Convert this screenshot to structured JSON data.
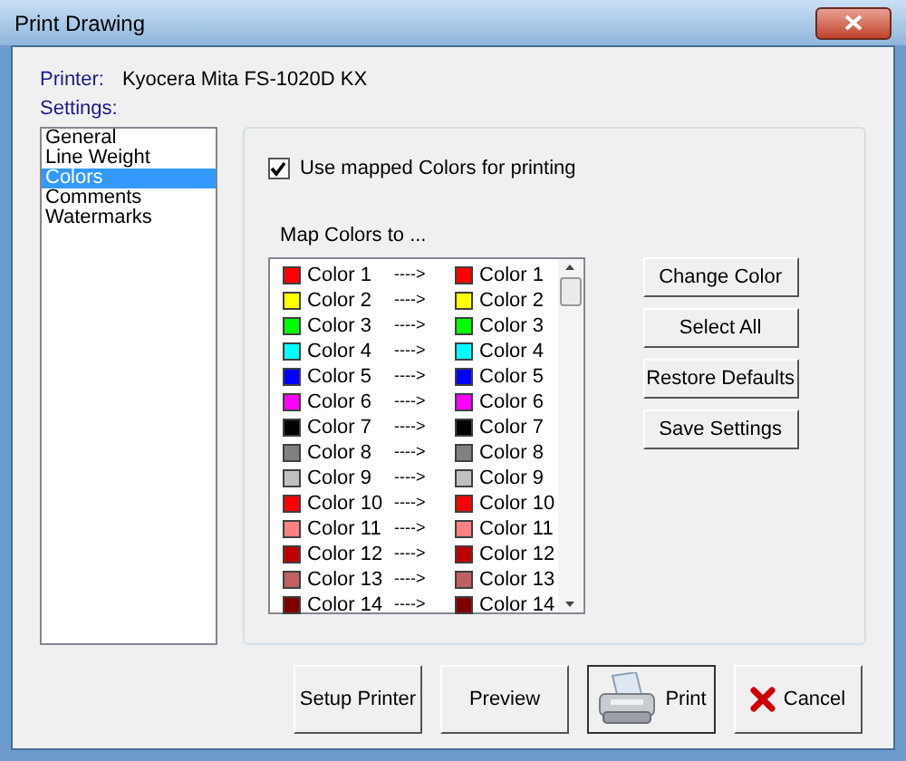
{
  "window": {
    "title": "Print Drawing"
  },
  "printer": {
    "label": "Printer:",
    "value": "Kyocera Mita FS-1020D KX"
  },
  "settings": {
    "label": "Settings:",
    "items": [
      {
        "label": "General",
        "selected": false
      },
      {
        "label": "Line Weight",
        "selected": false
      },
      {
        "label": "Colors",
        "selected": true
      },
      {
        "label": "Comments",
        "selected": false
      },
      {
        "label": "Watermarks",
        "selected": false
      }
    ]
  },
  "use_mapped": {
    "label": "Use mapped Colors for printing",
    "checked": true
  },
  "map_label": "Map Colors to ...",
  "color_map": [
    {
      "source": {
        "label": "Color 1",
        "color": "#ff0000"
      },
      "arrow": "---->",
      "target": {
        "label": "Color 1",
        "color": "#ff0000"
      }
    },
    {
      "source": {
        "label": "Color 2",
        "color": "#ffff00"
      },
      "arrow": "---->",
      "target": {
        "label": "Color 2",
        "color": "#ffff00"
      }
    },
    {
      "source": {
        "label": "Color 3",
        "color": "#00ff00"
      },
      "arrow": "---->",
      "target": {
        "label": "Color 3",
        "color": "#00ff00"
      }
    },
    {
      "source": {
        "label": "Color 4",
        "color": "#00ffff"
      },
      "arrow": "---->",
      "target": {
        "label": "Color 4",
        "color": "#00ffff"
      }
    },
    {
      "source": {
        "label": "Color 5",
        "color": "#0000ff"
      },
      "arrow": "---->",
      "target": {
        "label": "Color 5",
        "color": "#0000ff"
      }
    },
    {
      "source": {
        "label": "Color 6",
        "color": "#ff00ff"
      },
      "arrow": "---->",
      "target": {
        "label": "Color 6",
        "color": "#ff00ff"
      }
    },
    {
      "source": {
        "label": "Color 7",
        "color": "#000000"
      },
      "arrow": "---->",
      "target": {
        "label": "Color 7",
        "color": "#000000"
      }
    },
    {
      "source": {
        "label": "Color 8",
        "color": "#808080"
      },
      "arrow": "---->",
      "target": {
        "label": "Color 8",
        "color": "#808080"
      }
    },
    {
      "source": {
        "label": "Color 9",
        "color": "#c0c0c0"
      },
      "arrow": "---->",
      "target": {
        "label": "Color 9",
        "color": "#c0c0c0"
      }
    },
    {
      "source": {
        "label": "Color 10",
        "color": "#ff0000"
      },
      "arrow": "---->",
      "target": {
        "label": "Color 10",
        "color": "#ff0000"
      }
    },
    {
      "source": {
        "label": "Color 11",
        "color": "#ff8080"
      },
      "arrow": "---->",
      "target": {
        "label": "Color 11",
        "color": "#ff8080"
      }
    },
    {
      "source": {
        "label": "Color 12",
        "color": "#c00000"
      },
      "arrow": "---->",
      "target": {
        "label": "Color 12",
        "color": "#c00000"
      }
    },
    {
      "source": {
        "label": "Color 13",
        "color": "#c06060"
      },
      "arrow": "---->",
      "target": {
        "label": "Color 13",
        "color": "#c06060"
      }
    },
    {
      "source": {
        "label": "Color 14",
        "color": "#800000"
      },
      "arrow": "---->",
      "target": {
        "label": "Color 14",
        "color": "#800000"
      }
    }
  ],
  "side_buttons": [
    "Change Color",
    "Select All",
    "Restore Defaults",
    "Save Settings"
  ],
  "bottom_buttons": [
    {
      "label": "Setup Printer",
      "kind": "plain"
    },
    {
      "label": "Preview",
      "kind": "plain"
    },
    {
      "label": "Print",
      "kind": "print"
    },
    {
      "label": "Cancel",
      "kind": "cancel"
    }
  ]
}
